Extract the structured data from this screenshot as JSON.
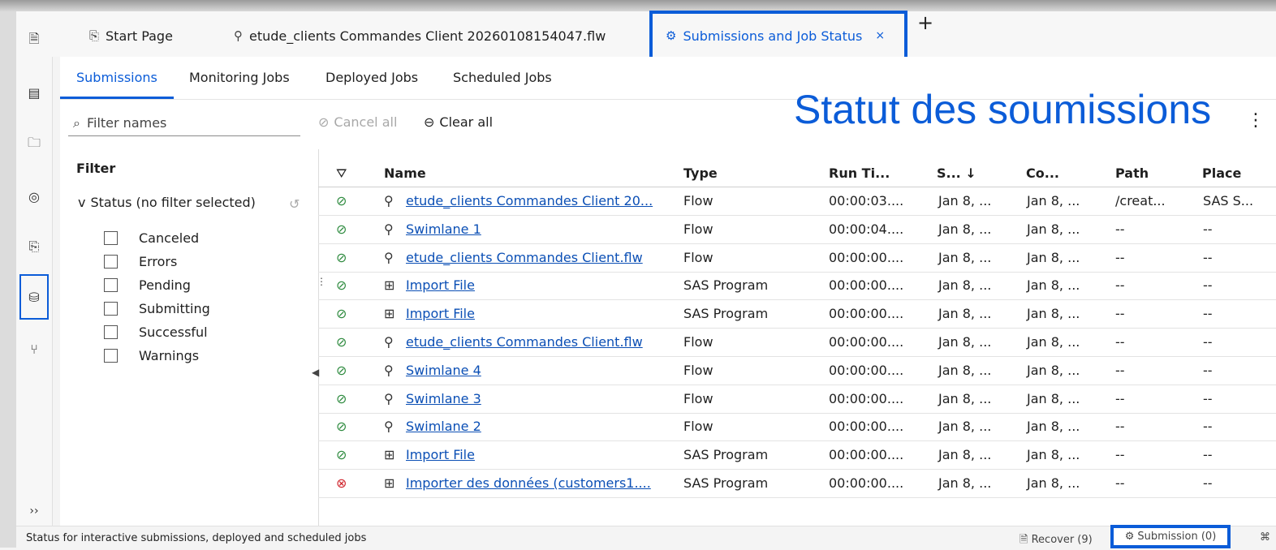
{
  "tabs": [
    {
      "icon": "start-page-icon",
      "label": "Start Page",
      "active": false
    },
    {
      "icon": "flow-icon",
      "label": "etude_clients Commandes Client 20260108154047.flw",
      "active": false
    },
    {
      "icon": "gear-icon",
      "label": "Submissions and Job Status",
      "active": true
    }
  ],
  "tab_close": "×",
  "add_tab": "+",
  "subtabs": [
    "Submissions",
    "Monitoring Jobs",
    "Deployed Jobs",
    "Scheduled Jobs"
  ],
  "toolbar": {
    "filter_placeholder": "Filter names",
    "cancel_all": "Cancel all",
    "clear_all": "Clear all",
    "kebab": "⋮"
  },
  "overlay_title": "Statut des soumissions",
  "filter": {
    "heading": "Filter",
    "status_label": "Status (no filter selected)",
    "expander": "v",
    "options": [
      "Canceled",
      "Errors",
      "Pending",
      "Submitting",
      "Successful",
      "Warnings"
    ]
  },
  "table": {
    "columns": [
      "Name",
      "Type",
      "Run Ti...",
      "S...  ↓",
      "Co...",
      "Path",
      "Place"
    ],
    "rows": [
      {
        "status": "success",
        "type_icon": "flow-icon",
        "name": "etude_clients Commandes Client 20...",
        "type": "Flow",
        "run_time": "00:00:03....",
        "start": "Jan 8, ...",
        "completed": "Jan 8, ...",
        "path": "/creat...",
        "place": "SAS S..."
      },
      {
        "status": "success",
        "type_icon": "flow-icon",
        "name": "Swimlane 1",
        "type": "Flow",
        "run_time": "00:00:04....",
        "start": "Jan 8, ...",
        "completed": "Jan 8, ...",
        "path": "--",
        "place": "--"
      },
      {
        "status": "success",
        "type_icon": "flow-icon",
        "name": "etude_clients Commandes Client.flw",
        "type": "Flow",
        "run_time": "00:00:00....",
        "start": "Jan 8, ...",
        "completed": "Jan 8, ...",
        "path": "--",
        "place": "--"
      },
      {
        "status": "success",
        "type_icon": "program-icon",
        "name": "Import File",
        "type": "SAS Program",
        "run_time": "00:00:00....",
        "start": "Jan 8, ...",
        "completed": "Jan 8, ...",
        "path": "--",
        "place": "--"
      },
      {
        "status": "success",
        "type_icon": "program-icon",
        "name": "Import File",
        "type": "SAS Program",
        "run_time": "00:00:00....",
        "start": "Jan 8, ...",
        "completed": "Jan 8, ...",
        "path": "--",
        "place": "--"
      },
      {
        "status": "success",
        "type_icon": "flow-icon",
        "name": "etude_clients Commandes Client.flw",
        "type": "Flow",
        "run_time": "00:00:00....",
        "start": "Jan 8, ...",
        "completed": "Jan 8, ...",
        "path": "--",
        "place": "--"
      },
      {
        "status": "success",
        "type_icon": "flow-icon",
        "name": "Swimlane 4",
        "type": "Flow",
        "run_time": "00:00:00....",
        "start": "Jan 8, ...",
        "completed": "Jan 8, ...",
        "path": "--",
        "place": "--"
      },
      {
        "status": "success",
        "type_icon": "flow-icon",
        "name": "Swimlane 3",
        "type": "Flow",
        "run_time": "00:00:00....",
        "start": "Jan 8, ...",
        "completed": "Jan 8, ...",
        "path": "--",
        "place": "--"
      },
      {
        "status": "success",
        "type_icon": "flow-icon",
        "name": "Swimlane 2",
        "type": "Flow",
        "run_time": "00:00:00....",
        "start": "Jan 8, ...",
        "completed": "Jan 8, ...",
        "path": "--",
        "place": "--"
      },
      {
        "status": "success",
        "type_icon": "program-icon",
        "name": "Import File",
        "type": "SAS Program",
        "run_time": "00:00:00....",
        "start": "Jan 8, ...",
        "completed": "Jan 8, ...",
        "path": "--",
        "place": "--"
      },
      {
        "status": "error",
        "type_icon": "program-icon",
        "name": "Importer des données (customers1....",
        "type": "SAS Program",
        "run_time": "00:00:00....",
        "start": "Jan 8, ...",
        "completed": "Jan 8, ...",
        "path": "--",
        "place": "--"
      }
    ]
  },
  "rail_more": "››",
  "statusbar": {
    "text": "Status for interactive submissions, deployed and scheduled jobs",
    "recover": "Recover (9)",
    "submission": "Submission (0)",
    "end_icon": "⌘"
  },
  "colors": {
    "accent": "#0b5cd8",
    "link": "#0b4fb5",
    "success": "#2d8a3e",
    "error": "#d0262e"
  }
}
